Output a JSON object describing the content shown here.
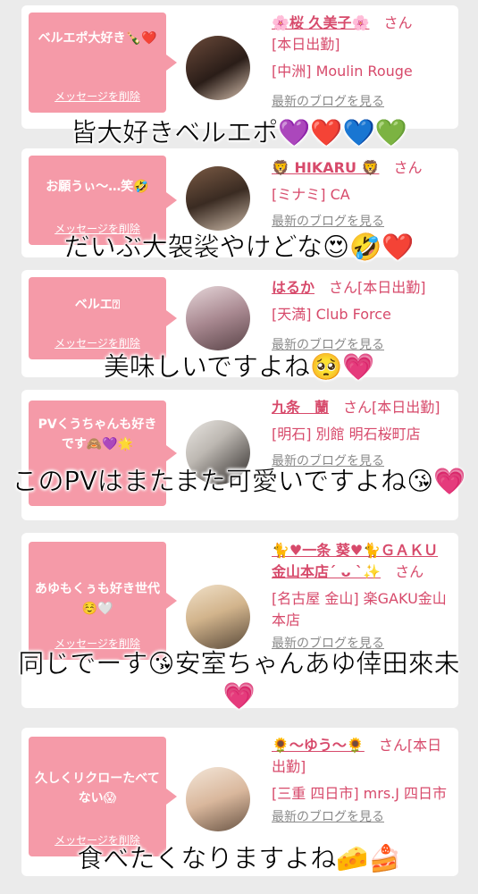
{
  "colors": {
    "bubble": "#f59aa8",
    "name_text": "#d74a6b",
    "page_bg": "#ebebeb"
  },
  "cards": [
    {
      "message": "ベルエポ大好き🍾❤️",
      "delete_label": "メッセージを削除",
      "name": "🌸桜 久美子🌸",
      "name_suffix": "さん",
      "line1": "[本日出勤]",
      "line2": "[中洲] Moulin Rouge",
      "blog": "最新のブログを見る",
      "caption": "皆大好きベルエポ💜❤️💙💚"
    },
    {
      "message": "お願うぃ〜…笑🤣",
      "delete_label": "メッセージを削除",
      "name": "🦁 HIKARU 🦁",
      "name_suffix": "さん",
      "line1": "[ミナミ] CA",
      "blog": "最新のブログを見る",
      "caption": "だいぶ大袈裟やけどな😍🤣❤️"
    },
    {
      "message": "ベルエ⍰",
      "delete_label": "メッセージを削除",
      "name": "はるか",
      "name_suffix": "さん[本日出勤]",
      "line1": "[天満] Club Force",
      "blog": "最新のブログを見る",
      "caption": "美味しいですよね🥺💗"
    },
    {
      "message": "PVくうちゃんも好きです🙈💜🌟",
      "delete_label": "メッセージを削除",
      "name": "九条　蘭",
      "name_suffix": "さん[本日出勤]",
      "line1": "[明石] 別館 明石桜町店",
      "blog": "最新のブログを見る",
      "caption": "このPVはまたまた可愛いですよね😘💗"
    },
    {
      "message": "あゆもくぅも好き世代☺️🤍",
      "delete_label": "メッセージを削除",
      "name": "🐈♥一条 葵♥🐈ＧＡＫＵ金山本店´ ᴗ `✨",
      "name_suffix": "さん",
      "line1": "[名古屋 金山] 楽GAKU金山本店",
      "blog": "最新のブログを見る",
      "caption": "同じでーす😘安室ちゃんあゆ倖田來未💗"
    },
    {
      "message": "久しくリクローたべてない😱",
      "delete_label": "メッセージを削除",
      "name": "🌻〜ゆう〜🌻",
      "name_suffix": "さん[本日出勤]",
      "line1": "[三重 四日市] mrs.J 四日市",
      "blog": "最新のブログを見る",
      "caption": "食べたくなりますよね🧀🍰"
    }
  ]
}
